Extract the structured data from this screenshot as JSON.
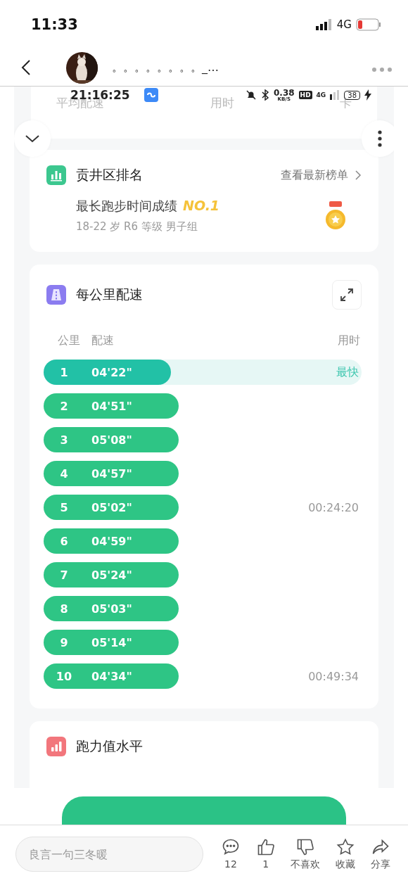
{
  "status_bar": {
    "time": "11:33",
    "network": "4G"
  },
  "header": {
    "title": "。。。。。。。。_…"
  },
  "inner_status_bar": {
    "time": "21:16:25",
    "speed": "0.38",
    "speed_unit": "KB/S",
    "hd": "HD",
    "network": "4G",
    "battery": "38"
  },
  "summary_labels": [
    "平均配速",
    "用时",
    "卡"
  ],
  "ranking_card": {
    "title": "贡井区排名",
    "link": "查看最新榜单",
    "achievement": "最长跑步时间成绩",
    "rank": "NO.1",
    "group": "18-22 岁 R6 等级 男子组"
  },
  "pace_card": {
    "title": "每公里配速",
    "columns": [
      "公里",
      "配速",
      "用时"
    ],
    "rows": [
      {
        "km": "1",
        "pace": "04'22\"",
        "fastest": true,
        "level": 0.4,
        "note": "最快"
      },
      {
        "km": "2",
        "pace": "04'51\"",
        "fastest": false
      },
      {
        "km": "3",
        "pace": "05'08\"",
        "fastest": false
      },
      {
        "km": "4",
        "pace": "04'57\"",
        "fastest": false
      },
      {
        "km": "5",
        "pace": "05'02\"",
        "fastest": false,
        "time": "00:24:20"
      },
      {
        "km": "6",
        "pace": "04'59\"",
        "fastest": false
      },
      {
        "km": "7",
        "pace": "05'24\"",
        "fastest": false
      },
      {
        "km": "8",
        "pace": "05'03\"",
        "fastest": false
      },
      {
        "km": "9",
        "pace": "05'14\"",
        "fastest": false
      },
      {
        "km": "10",
        "pace": "04'34\"",
        "fastest": false,
        "time": "00:49:34"
      }
    ]
  },
  "level_card": {
    "title": "跑力值水平"
  },
  "bottom_bar": {
    "comment_placeholder": "良言一句三冬暖",
    "actions": [
      {
        "kind": "comment",
        "label": "12"
      },
      {
        "kind": "like",
        "label": "1"
      },
      {
        "kind": "dislike",
        "label": "不喜欢"
      },
      {
        "kind": "favorite",
        "label": "收藏"
      },
      {
        "kind": "share",
        "label": "分享"
      }
    ]
  }
}
